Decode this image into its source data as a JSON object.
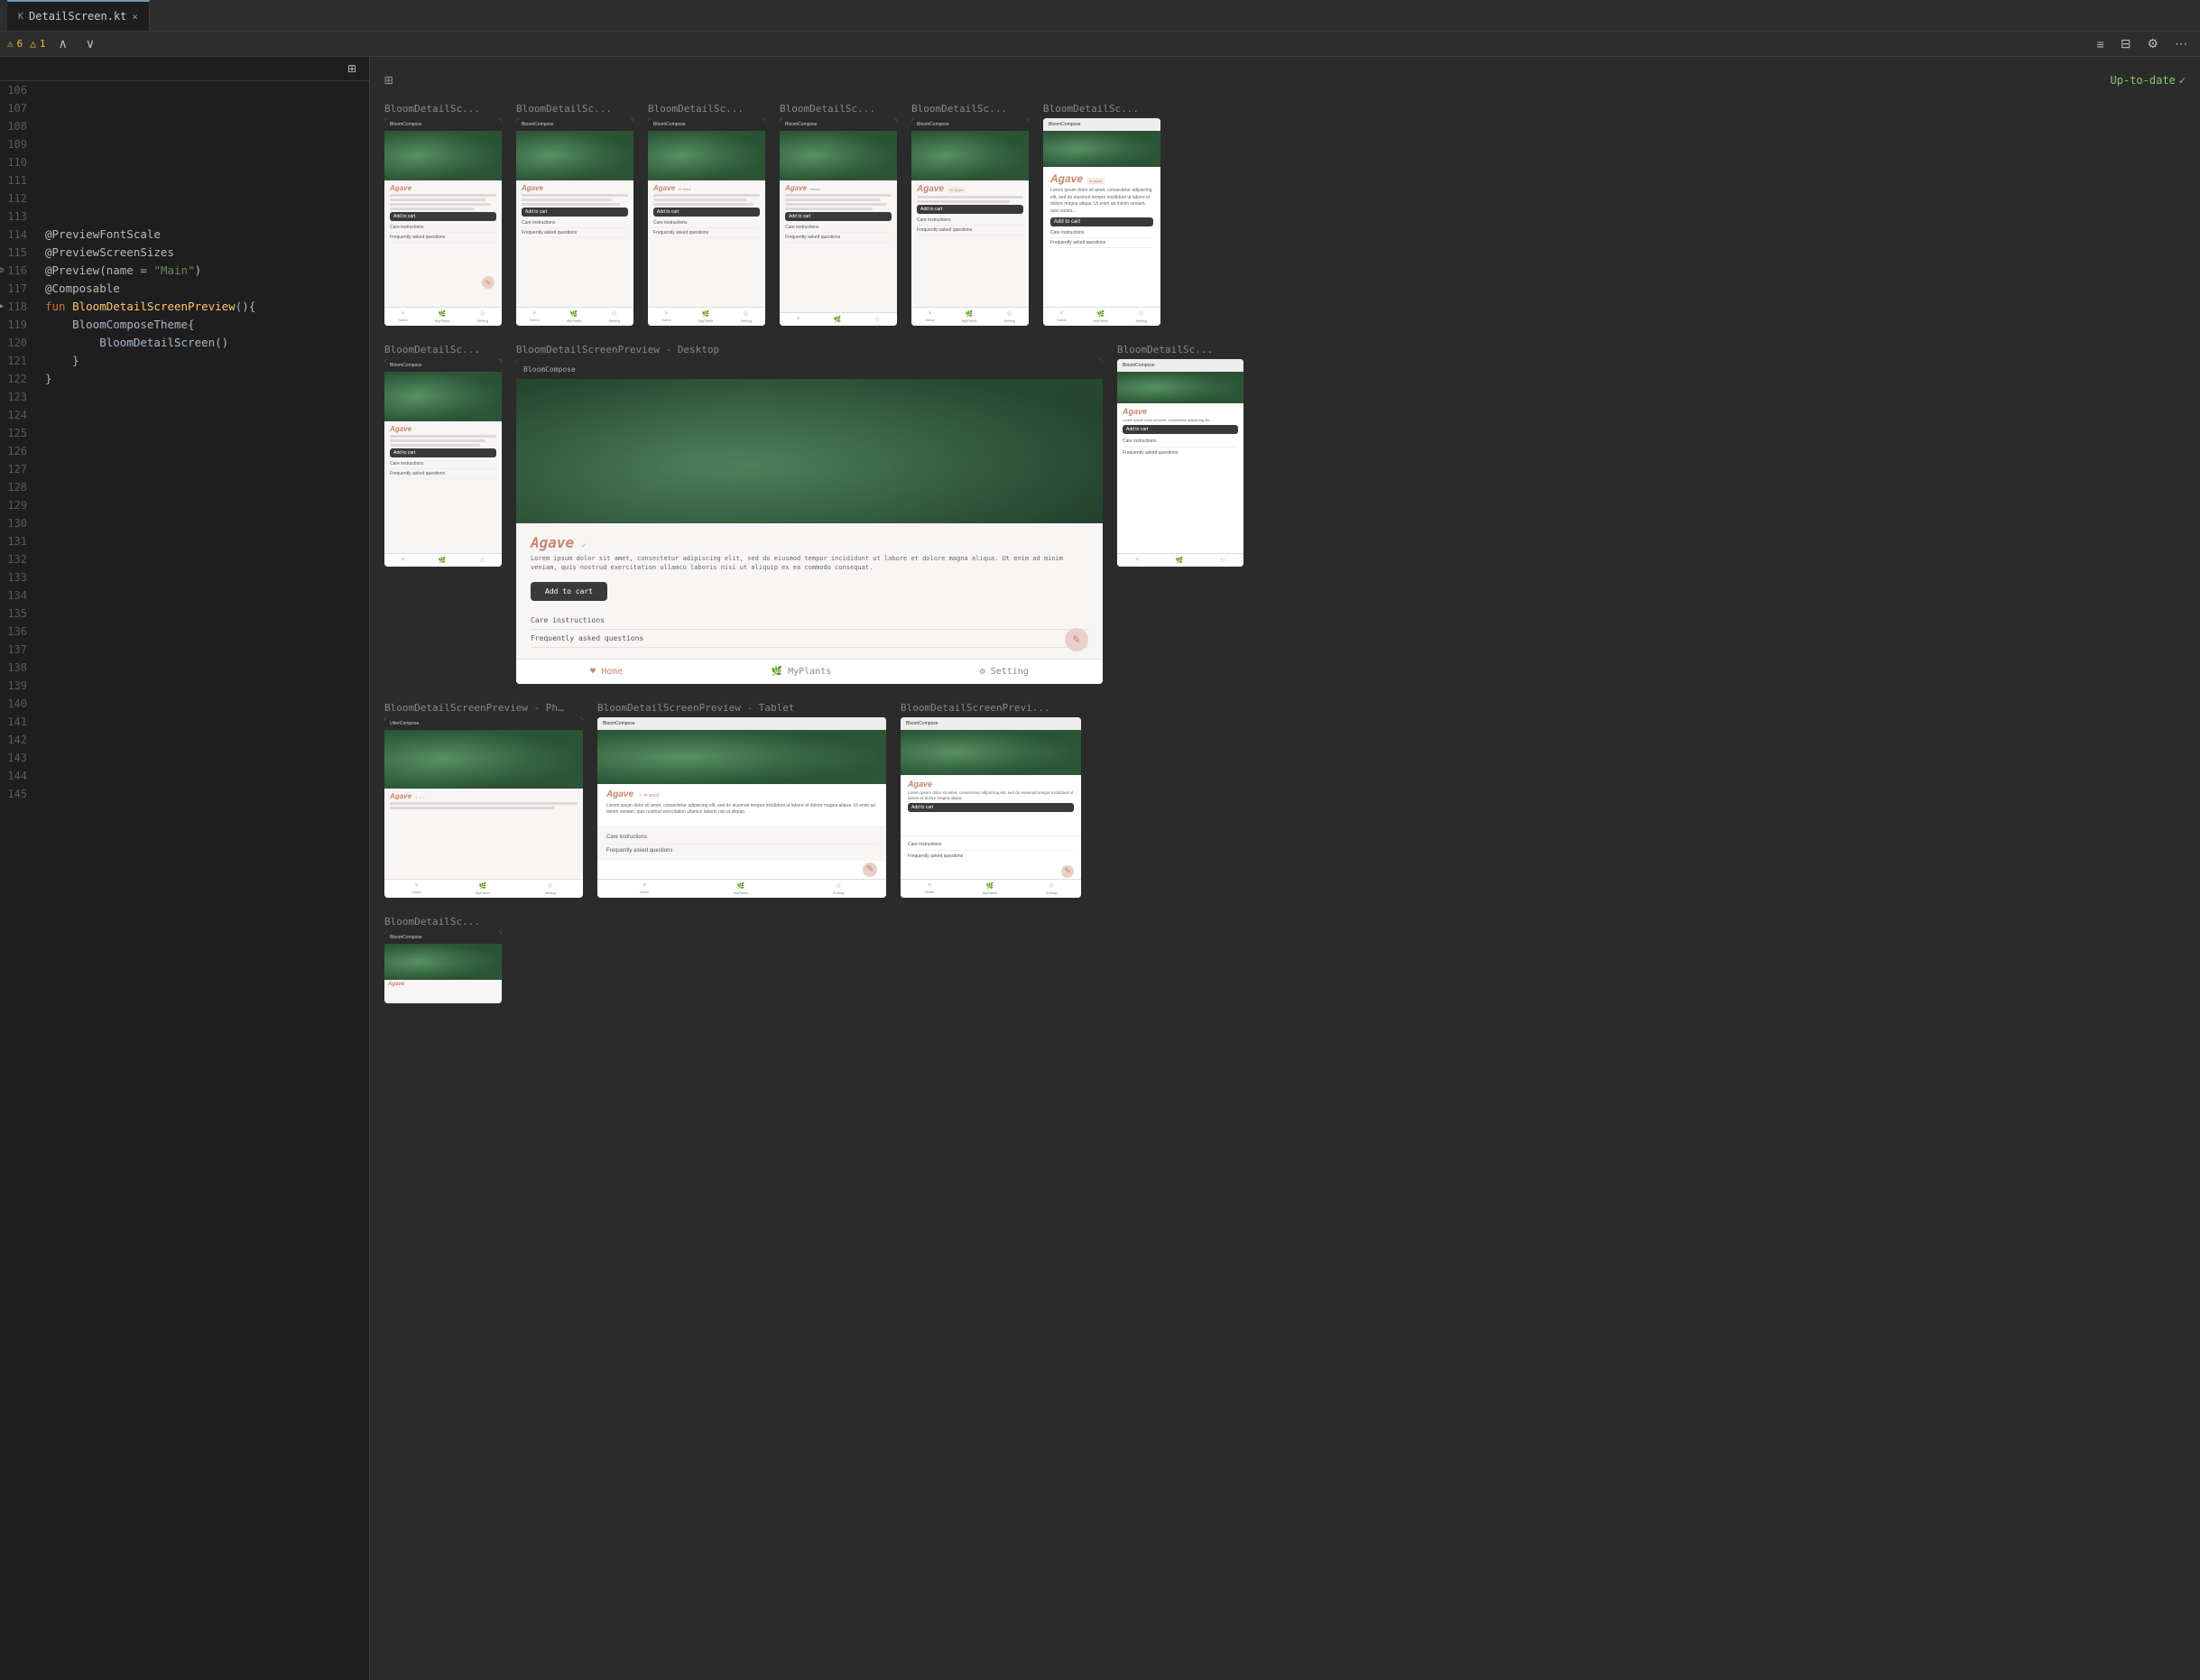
{
  "tab": {
    "filename": "DetailScreen.kt",
    "close_label": "×",
    "file_icon": "kt"
  },
  "toolbar": {
    "warning_count": "6",
    "info_count": "1",
    "layout_icon": "⊞",
    "status": "Up-to-date",
    "status_icon": "✓",
    "menu_icon": "≡",
    "split_icon": "⊟",
    "settings_icon": "⚙",
    "more_icon": "⋯"
  },
  "editor": {
    "lines": [
      {
        "num": 106,
        "code": ""
      },
      {
        "num": 107,
        "code": ""
      },
      {
        "num": 108,
        "code": ""
      },
      {
        "num": 109,
        "code": ""
      },
      {
        "num": 110,
        "code": ""
      },
      {
        "num": 111,
        "code": ""
      },
      {
        "num": 112,
        "code": ""
      },
      {
        "num": 113,
        "code": ""
      },
      {
        "num": 114,
        "code": "@PreviewFontScale",
        "type": "annotation"
      },
      {
        "num": 115,
        "code": "@PreviewScreenSizes",
        "type": "annotation"
      },
      {
        "num": 116,
        "code": "@Preview(name = \"Main\")",
        "type": "annotation",
        "has_gear": true
      },
      {
        "num": 117,
        "code": "@Composable",
        "type": "annotation"
      },
      {
        "num": 118,
        "code": "fun BloomDetailScreenPreview(){",
        "type": "function",
        "has_icon": true
      },
      {
        "num": 119,
        "code": "    BloomComposeTheme{",
        "type": "code"
      },
      {
        "num": 120,
        "code": "        BloomDetailScreen()",
        "type": "code"
      },
      {
        "num": 121,
        "code": "    }",
        "type": "code"
      },
      {
        "num": 122,
        "code": "}",
        "type": "code"
      },
      {
        "num": 123,
        "code": ""
      },
      {
        "num": 124,
        "code": ""
      },
      {
        "num": 125,
        "code": ""
      },
      {
        "num": 126,
        "code": ""
      },
      {
        "num": 127,
        "code": ""
      },
      {
        "num": 128,
        "code": ""
      },
      {
        "num": 129,
        "code": ""
      },
      {
        "num": 130,
        "code": ""
      },
      {
        "num": 131,
        "code": ""
      },
      {
        "num": 132,
        "code": ""
      },
      {
        "num": 133,
        "code": ""
      },
      {
        "num": 134,
        "code": ""
      },
      {
        "num": 135,
        "code": ""
      },
      {
        "num": 136,
        "code": ""
      },
      {
        "num": 137,
        "code": ""
      },
      {
        "num": 138,
        "code": ""
      },
      {
        "num": 139,
        "code": ""
      },
      {
        "num": 140,
        "code": ""
      },
      {
        "num": 141,
        "code": ""
      },
      {
        "num": 142,
        "code": ""
      },
      {
        "num": 143,
        "code": ""
      },
      {
        "num": 144,
        "code": ""
      },
      {
        "num": 145,
        "code": ""
      }
    ]
  },
  "preview": {
    "status": "Up-to-date",
    "status_check": "✓",
    "cards_row1": [
      {
        "title": "BloomDetailSc...",
        "size": "small"
      },
      {
        "title": "BloomDetailSc...",
        "size": "small"
      },
      {
        "title": "BloomDetailSc...",
        "size": "small"
      },
      {
        "title": "BloomDetailSc...",
        "size": "small"
      },
      {
        "title": "BloomDetailSc...",
        "size": "small"
      },
      {
        "title": "BloomDetailSc...",
        "size": "small"
      }
    ],
    "cards_row2_left": {
      "title": "BloomDetailSc...",
      "size": "small"
    },
    "cards_row2_center": {
      "title": "BloomDetailScreenPreview - Desktop",
      "size": "large"
    },
    "cards_row2_right": {
      "title": "BloomDetailSc...",
      "size": "small"
    },
    "cards_row3": [
      {
        "title": "BloomDetailScreenPreview - Pho...",
        "size": "medium"
      },
      {
        "title": "BloomDetailScreenPreview - Tablet",
        "size": "medium"
      },
      {
        "title": "BloomDetailScreenPrevi...",
        "size": "medium"
      }
    ],
    "cards_row4_left": {
      "title": "BloomDetailSc...",
      "size": "small"
    },
    "plant_name": "Agave",
    "plant_status_in_stock": "In stock",
    "plant_status_mixed": "",
    "care_instructions": "Care instructions",
    "faq": "Frequently asked questions",
    "nav_items": [
      "Home",
      "MyPlants",
      "Setting"
    ],
    "nav_icons": [
      "♥",
      "🌿",
      "⚙"
    ],
    "add_to_cart": "Add to cart",
    "lorem_short": "Lorem ipsum dolor sit amet, consectetur adipiscing elit.",
    "lorem_long": "Lorem ipsum dolor sit amet, consectetur adipiscing elit, sed do eiusmod tempor incididunt ut labore et dolore magna aliqua. Ut enim ad minim veniam, quis nostru..."
  }
}
